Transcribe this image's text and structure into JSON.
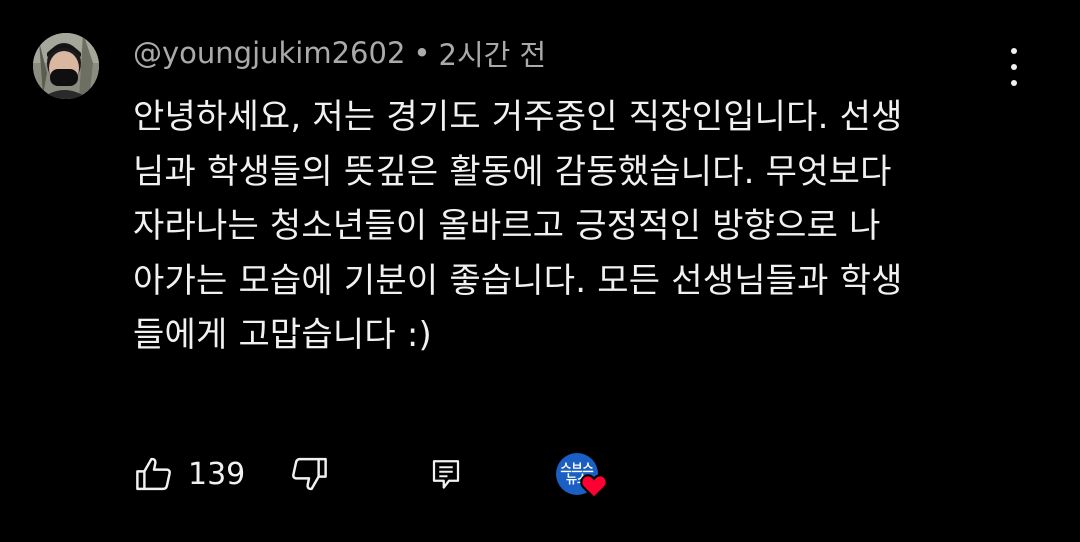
{
  "comment": {
    "author": "@youngjukim2602",
    "separator": "•",
    "timestamp": "2시간 전",
    "lines": [
      "안녕하세요, 저는 경기도 거주중인 직장인입니다. 선생",
      "님과 학생들의 뜻깊은 활동에 감동했습니다. 무엇보다",
      "자라나는 청소년들이 올바르고 긍정적인 방향으로 나",
      "아가는 모습에 기분이 좋습니다. 모든 선생님들과 학생",
      "들에게 고맙습니다 :)"
    ],
    "like_count": "139",
    "creator_badge_text": "스브스\n뉴스"
  },
  "icons": {
    "more": "more-vert-icon",
    "like": "thumbs-up-icon",
    "dislike": "thumbs-down-icon",
    "reply": "reply-comment-icon",
    "heart": "heart-icon"
  },
  "colors": {
    "background": "#000000",
    "text": "#f1f1f1",
    "secondary": "#aaaaaa",
    "heart": "#ff0033",
    "creator_badge": "#1a5fc4"
  }
}
